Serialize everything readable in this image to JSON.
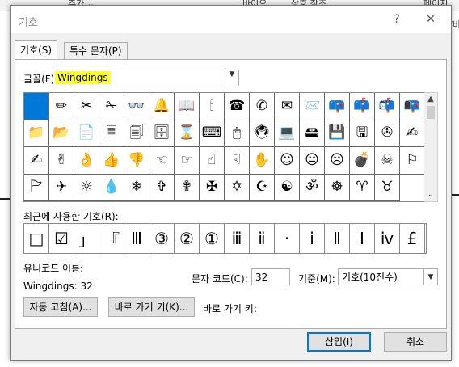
{
  "background": {
    "items": [
      "추가 ⌄",
      "바이오",
      "상호 참조",
      "페이지",
      "/비"
    ]
  },
  "dialog": {
    "title": "기호",
    "help": "?",
    "close": "✕"
  },
  "tabs": [
    {
      "label": "기호(S)",
      "active": true
    },
    {
      "label": "특수 문자(P)",
      "active": false
    }
  ],
  "font": {
    "label": "글꼴(F):",
    "value": "Wingdings"
  },
  "symbols": [
    "",
    "✏",
    "✂",
    "✁",
    "👓",
    "🔔",
    "📖",
    "🕯",
    "☎",
    "✆",
    "✉",
    "📨",
    "📪",
    "📫",
    "📬",
    "📭",
    "📁",
    "📂",
    "📄",
    "🗏",
    "🗐",
    "🗄",
    "⌛",
    "⌨",
    "🖱",
    "🖲",
    "💻",
    "🖴",
    "💾",
    "🖫",
    "✇",
    "✍",
    "✍",
    "✌",
    "👌",
    "👍",
    "👎",
    "☜",
    "☞",
    "☝",
    "☟",
    "✋",
    "☺",
    "😐",
    "☹",
    "💣",
    "☠",
    "⚐",
    "🏱",
    "✈",
    "☼",
    "💧",
    "❄",
    "✞",
    "✟",
    "✠",
    "✡",
    "☪",
    "☯",
    "ॐ",
    "☸",
    "♈",
    "♉"
  ],
  "scroll": {
    "up": "▲",
    "down": "⌄"
  },
  "recent": {
    "label": "최근에 사용한 기호(R):",
    "items": [
      "□",
      "☑",
      "」",
      "『",
      "Ⅲ",
      "③",
      "②",
      "①",
      "ⅲ",
      "ⅱ",
      "·",
      "ⅰ",
      "Ⅱ",
      "Ⅰ",
      "ⅳ",
      "£"
    ]
  },
  "unicode_name": {
    "label": "유니코드 이름:",
    "value": "Wingdings: 32"
  },
  "char_code": {
    "label": "문자 코드(C):",
    "value": "32"
  },
  "base": {
    "label": "기준(M):",
    "value": "기호(10진수)"
  },
  "buttons": {
    "autocorrect": "자동 고침(A)...",
    "shortcut_key": "바로 가기 키(K)...",
    "shortcut_label": "바로 가기 키:",
    "insert": "삽입(I)",
    "cancel": "취소"
  }
}
